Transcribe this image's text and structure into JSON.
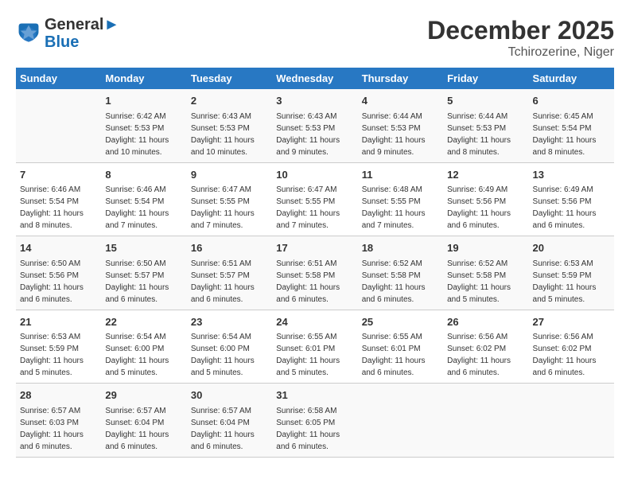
{
  "header": {
    "logo_line1": "General",
    "logo_line2": "Blue",
    "month": "December 2025",
    "location": "Tchirozerine, Niger"
  },
  "calendar": {
    "days_of_week": [
      "Sunday",
      "Monday",
      "Tuesday",
      "Wednesday",
      "Thursday",
      "Friday",
      "Saturday"
    ],
    "weeks": [
      [
        {
          "day": "",
          "info": ""
        },
        {
          "day": "1",
          "info": "Sunrise: 6:42 AM\nSunset: 5:53 PM\nDaylight: 11 hours\nand 10 minutes."
        },
        {
          "day": "2",
          "info": "Sunrise: 6:43 AM\nSunset: 5:53 PM\nDaylight: 11 hours\nand 10 minutes."
        },
        {
          "day": "3",
          "info": "Sunrise: 6:43 AM\nSunset: 5:53 PM\nDaylight: 11 hours\nand 9 minutes."
        },
        {
          "day": "4",
          "info": "Sunrise: 6:44 AM\nSunset: 5:53 PM\nDaylight: 11 hours\nand 9 minutes."
        },
        {
          "day": "5",
          "info": "Sunrise: 6:44 AM\nSunset: 5:53 PM\nDaylight: 11 hours\nand 8 minutes."
        },
        {
          "day": "6",
          "info": "Sunrise: 6:45 AM\nSunset: 5:54 PM\nDaylight: 11 hours\nand 8 minutes."
        }
      ],
      [
        {
          "day": "7",
          "info": "Sunrise: 6:46 AM\nSunset: 5:54 PM\nDaylight: 11 hours\nand 8 minutes."
        },
        {
          "day": "8",
          "info": "Sunrise: 6:46 AM\nSunset: 5:54 PM\nDaylight: 11 hours\nand 7 minutes."
        },
        {
          "day": "9",
          "info": "Sunrise: 6:47 AM\nSunset: 5:55 PM\nDaylight: 11 hours\nand 7 minutes."
        },
        {
          "day": "10",
          "info": "Sunrise: 6:47 AM\nSunset: 5:55 PM\nDaylight: 11 hours\nand 7 minutes."
        },
        {
          "day": "11",
          "info": "Sunrise: 6:48 AM\nSunset: 5:55 PM\nDaylight: 11 hours\nand 7 minutes."
        },
        {
          "day": "12",
          "info": "Sunrise: 6:49 AM\nSunset: 5:56 PM\nDaylight: 11 hours\nand 6 minutes."
        },
        {
          "day": "13",
          "info": "Sunrise: 6:49 AM\nSunset: 5:56 PM\nDaylight: 11 hours\nand 6 minutes."
        }
      ],
      [
        {
          "day": "14",
          "info": "Sunrise: 6:50 AM\nSunset: 5:56 PM\nDaylight: 11 hours\nand 6 minutes."
        },
        {
          "day": "15",
          "info": "Sunrise: 6:50 AM\nSunset: 5:57 PM\nDaylight: 11 hours\nand 6 minutes."
        },
        {
          "day": "16",
          "info": "Sunrise: 6:51 AM\nSunset: 5:57 PM\nDaylight: 11 hours\nand 6 minutes."
        },
        {
          "day": "17",
          "info": "Sunrise: 6:51 AM\nSunset: 5:58 PM\nDaylight: 11 hours\nand 6 minutes."
        },
        {
          "day": "18",
          "info": "Sunrise: 6:52 AM\nSunset: 5:58 PM\nDaylight: 11 hours\nand 6 minutes."
        },
        {
          "day": "19",
          "info": "Sunrise: 6:52 AM\nSunset: 5:58 PM\nDaylight: 11 hours\nand 5 minutes."
        },
        {
          "day": "20",
          "info": "Sunrise: 6:53 AM\nSunset: 5:59 PM\nDaylight: 11 hours\nand 5 minutes."
        }
      ],
      [
        {
          "day": "21",
          "info": "Sunrise: 6:53 AM\nSunset: 5:59 PM\nDaylight: 11 hours\nand 5 minutes."
        },
        {
          "day": "22",
          "info": "Sunrise: 6:54 AM\nSunset: 6:00 PM\nDaylight: 11 hours\nand 5 minutes."
        },
        {
          "day": "23",
          "info": "Sunrise: 6:54 AM\nSunset: 6:00 PM\nDaylight: 11 hours\nand 5 minutes."
        },
        {
          "day": "24",
          "info": "Sunrise: 6:55 AM\nSunset: 6:01 PM\nDaylight: 11 hours\nand 5 minutes."
        },
        {
          "day": "25",
          "info": "Sunrise: 6:55 AM\nSunset: 6:01 PM\nDaylight: 11 hours\nand 6 minutes."
        },
        {
          "day": "26",
          "info": "Sunrise: 6:56 AM\nSunset: 6:02 PM\nDaylight: 11 hours\nand 6 minutes."
        },
        {
          "day": "27",
          "info": "Sunrise: 6:56 AM\nSunset: 6:02 PM\nDaylight: 11 hours\nand 6 minutes."
        }
      ],
      [
        {
          "day": "28",
          "info": "Sunrise: 6:57 AM\nSunset: 6:03 PM\nDaylight: 11 hours\nand 6 minutes."
        },
        {
          "day": "29",
          "info": "Sunrise: 6:57 AM\nSunset: 6:04 PM\nDaylight: 11 hours\nand 6 minutes."
        },
        {
          "day": "30",
          "info": "Sunrise: 6:57 AM\nSunset: 6:04 PM\nDaylight: 11 hours\nand 6 minutes."
        },
        {
          "day": "31",
          "info": "Sunrise: 6:58 AM\nSunset: 6:05 PM\nDaylight: 11 hours\nand 6 minutes."
        },
        {
          "day": "",
          "info": ""
        },
        {
          "day": "",
          "info": ""
        },
        {
          "day": "",
          "info": ""
        }
      ]
    ]
  }
}
